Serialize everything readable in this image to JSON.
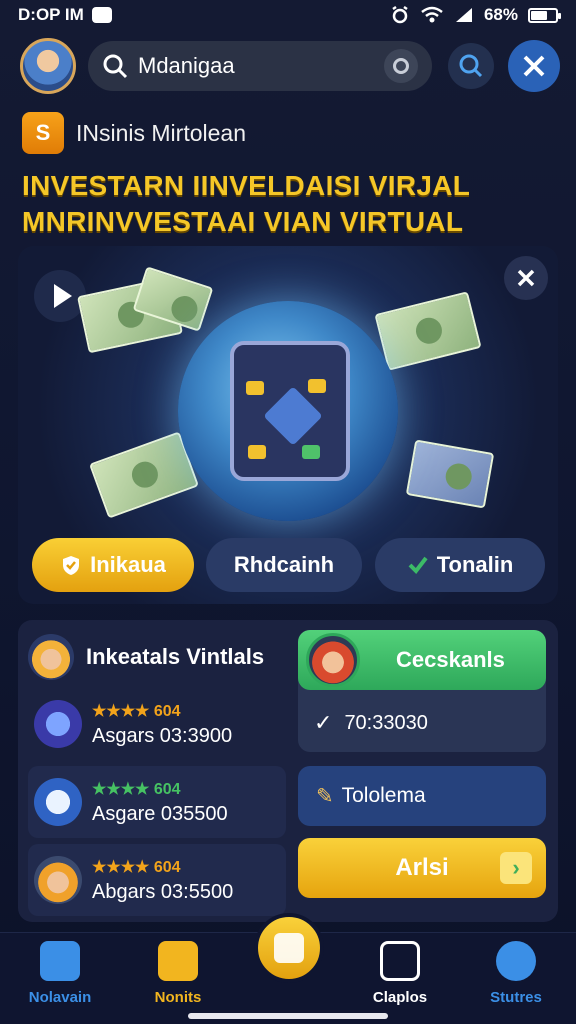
{
  "status_bar": {
    "time": "D:OP IM",
    "battery": "68%",
    "battery_level": 0.68
  },
  "search": {
    "value": "Mdanigaa"
  },
  "brand": {
    "name": "INsinis Mirtolean",
    "logo_text": "S"
  },
  "headlines": {
    "line1": "INVESTARN IINVELDAISI VIRJAL",
    "line2": "MNRINVVESTAAI VIAN VIRTUAL"
  },
  "hero": {
    "buttons": [
      {
        "label": "Inikaua"
      },
      {
        "label": "Rhdcainh"
      },
      {
        "label": "Tonalin"
      }
    ]
  },
  "investors": {
    "title": "Inkeatals Vintlals",
    "rows": [
      {
        "stars": "★★★★",
        "rating": "604",
        "amount": "Asgars 03:3900",
        "star_color": "#f2a31b"
      },
      {
        "stars": "★★★★",
        "rating": "604",
        "amount": "Asgare 035500",
        "star_color": "#46c263"
      },
      {
        "stars": "★★★★",
        "rating": "604",
        "amount": "Abgars 03:5500",
        "star_color": "#f2a31b"
      }
    ]
  },
  "side": {
    "green_label": "Cecskanls",
    "time_text": "70:33030",
    "blue_label": "Tololema",
    "yellow_label": "Arlsi"
  },
  "bottom_nav": [
    {
      "label": "Nolavain",
      "color": "#3b8fe6"
    },
    {
      "label": "Nonits",
      "color": "#f2b51f"
    },
    {
      "label": "Claplos",
      "color": "#ffffff"
    },
    {
      "label": "Stutres",
      "color": "#3b8fe6"
    }
  ],
  "colors": {
    "accent_yellow": "#f5c728",
    "accent_blue": "#2a62b7",
    "accent_green": "#3cba67",
    "background": "#111832"
  }
}
